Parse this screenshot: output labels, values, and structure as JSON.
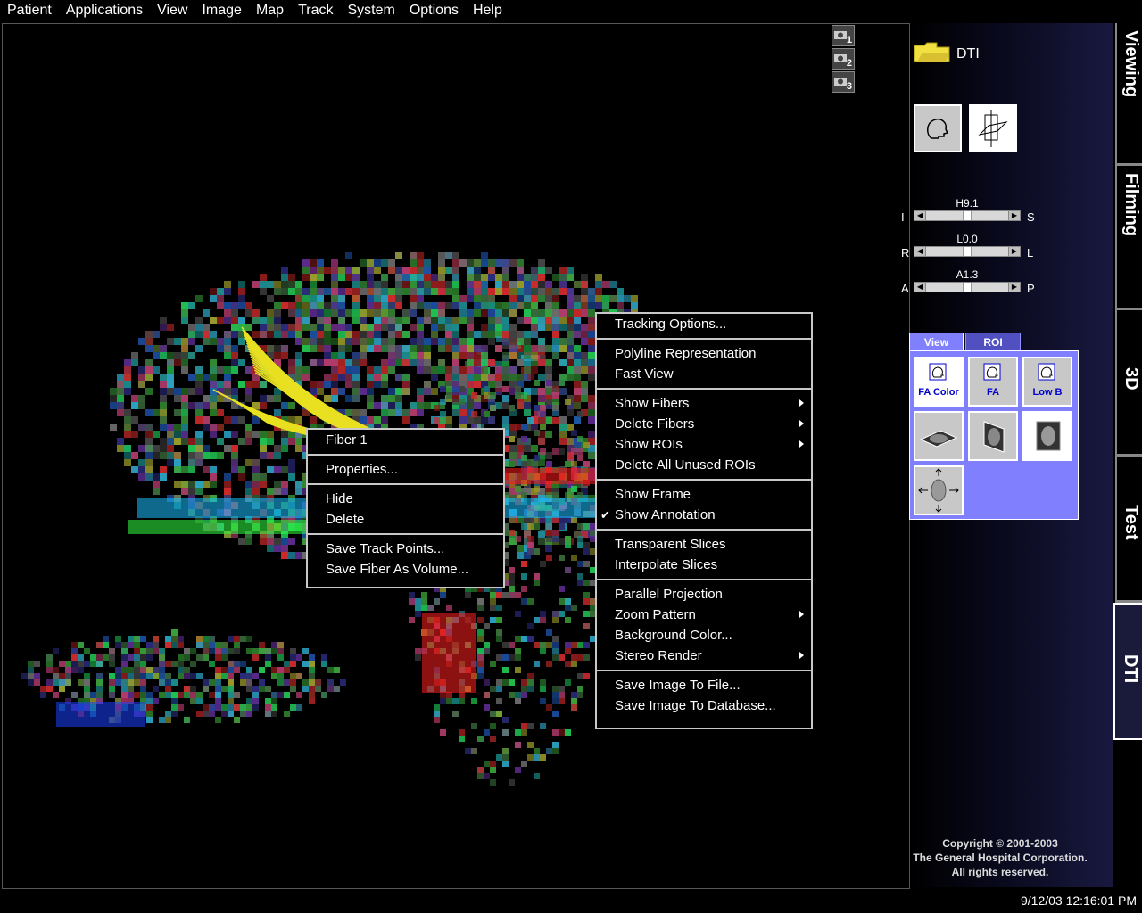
{
  "menubar": {
    "items": [
      {
        "label": "Patient"
      },
      {
        "label": "Applications"
      },
      {
        "label": "View"
      },
      {
        "label": "Image"
      },
      {
        "label": "Map"
      },
      {
        "label": "Track"
      },
      {
        "label": "System"
      },
      {
        "label": "Options"
      },
      {
        "label": "Help"
      }
    ]
  },
  "camera_buttons": [
    "1",
    "2",
    "3"
  ],
  "panel": {
    "folder_label": "DTI",
    "sliders": [
      {
        "value": "H9.1",
        "left": "I",
        "right": "S"
      },
      {
        "value": "L0.0",
        "left": "R",
        "right": "L"
      },
      {
        "value": "A1.3",
        "left": "A",
        "right": "P"
      }
    ],
    "tabs": [
      "View",
      "ROI"
    ],
    "view_buttons": [
      "FA Color",
      "FA",
      "Low B"
    ]
  },
  "side_tabs": [
    "Viewing",
    "Filming",
    "3D",
    "Test",
    "DTI"
  ],
  "copyright": [
    "Copyright © 2001-2003",
    "The General Hospital Corporation.",
    "All rights reserved."
  ],
  "timestamp": "9/12/03 12:16:01 PM",
  "fiber_menu": {
    "title": "Fiber 1",
    "groups": [
      [
        "Properties..."
      ],
      [
        "Hide",
        "Delete"
      ],
      [
        "Save Track Points...",
        "Save Fiber As Volume..."
      ]
    ]
  },
  "view_menu": {
    "groups": [
      [
        {
          "label": "Tracking Options..."
        }
      ],
      [
        {
          "label": "Polyline Representation"
        },
        {
          "label": "Fast View"
        }
      ],
      [
        {
          "label": "Show Fibers",
          "sub": true
        },
        {
          "label": "Delete Fibers",
          "sub": true
        },
        {
          "label": "Show ROIs",
          "sub": true
        },
        {
          "label": "Delete All Unused ROIs"
        }
      ],
      [
        {
          "label": "Show Frame"
        },
        {
          "label": "Show Annotation",
          "checked": true
        }
      ],
      [
        {
          "label": "Transparent Slices"
        },
        {
          "label": "Interpolate Slices"
        }
      ],
      [
        {
          "label": "Parallel Projection"
        },
        {
          "label": "Zoom Pattern",
          "sub": true
        },
        {
          "label": "Background Color..."
        },
        {
          "label": "Stereo Render",
          "sub": true
        }
      ],
      [
        {
          "label": "Save Image To File..."
        },
        {
          "label": "Save Image To Database..."
        }
      ]
    ]
  },
  "colors": {
    "tab_active": "#8080ff",
    "menu_border": "#c8c8c8",
    "fiber": "#e8e020"
  }
}
